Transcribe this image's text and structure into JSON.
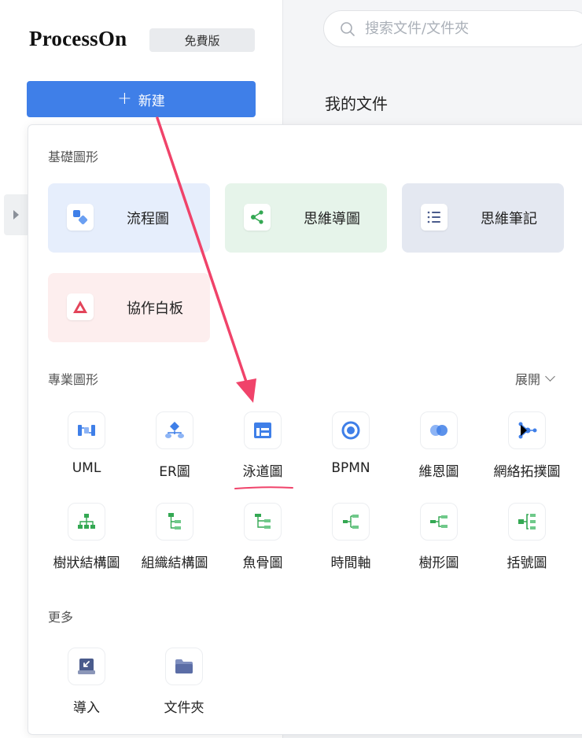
{
  "brand": {
    "name": "ProcessOn",
    "plan_badge": "免費版"
  },
  "new_button": {
    "label": "新建"
  },
  "search": {
    "placeholder": "搜索文件/文件夾"
  },
  "main": {
    "title": "我的文件"
  },
  "menu": {
    "basic": {
      "title": "基礎圖形",
      "items": [
        {
          "label": "流程圖",
          "icon": "flowchart-icon",
          "bg": "#e6eefc"
        },
        {
          "label": "思維導圖",
          "icon": "mindmap-icon",
          "bg": "#e6f4ea"
        },
        {
          "label": "思維筆記",
          "icon": "notes-icon",
          "bg": "#e4e8f1"
        },
        {
          "label": "協作白板",
          "icon": "whiteboard-icon",
          "bg": "#fdeeee"
        }
      ]
    },
    "professional": {
      "title": "專業圖形",
      "expand_label": "展開",
      "items": [
        {
          "label": "UML",
          "icon": "uml-icon"
        },
        {
          "label": "ER圖",
          "icon": "er-diagram-icon"
        },
        {
          "label": "泳道圖",
          "icon": "swimlane-icon"
        },
        {
          "label": "BPMN",
          "icon": "bpmn-icon"
        },
        {
          "label": "維恩圖",
          "icon": "venn-icon"
        },
        {
          "label": "網絡拓撲圖",
          "icon": "network-topology-icon"
        },
        {
          "label": "樹狀結構圖",
          "icon": "tree-structure-icon"
        },
        {
          "label": "組織結構圖",
          "icon": "org-chart-icon"
        },
        {
          "label": "魚骨圖",
          "icon": "fishbone-icon"
        },
        {
          "label": "時間軸",
          "icon": "timeline-icon"
        },
        {
          "label": "樹形圖",
          "icon": "tree-diagram-icon"
        },
        {
          "label": "括號圖",
          "icon": "bracket-icon"
        }
      ]
    },
    "more": {
      "title": "更多",
      "items": [
        {
          "label": "導入",
          "icon": "import-icon"
        },
        {
          "label": "文件夾",
          "icon": "folder-icon"
        }
      ]
    }
  },
  "colors": {
    "accent": "#3f7fe8",
    "annotation": "#f0436a"
  }
}
